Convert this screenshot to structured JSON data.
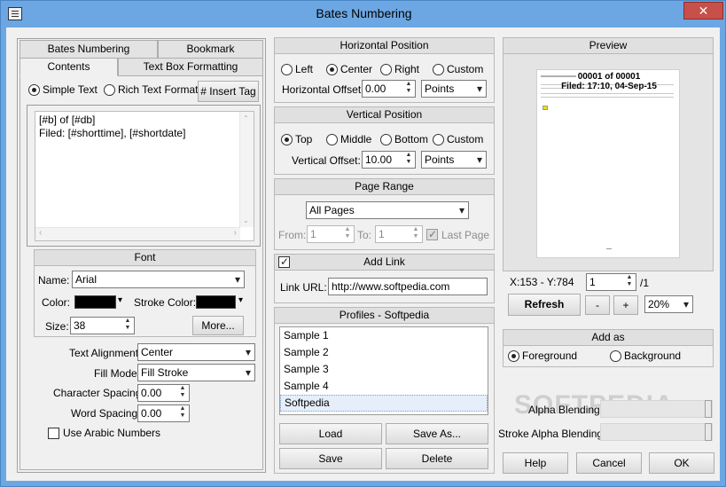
{
  "window": {
    "title": "Bates Numbering",
    "close_glyph": "✕",
    "min_glyph": "─",
    "max_glyph": "☐"
  },
  "left": {
    "tabs_row1": [
      "Bates Numbering",
      "Bookmark"
    ],
    "tabs_row2": [
      "Contents",
      "Text Box Formatting"
    ],
    "text_mode": {
      "simple": "Simple Text",
      "rich": "Rich Text Format",
      "selected": "simple"
    },
    "insert_tag": "# Insert Tag",
    "editor_lines": [
      "[#b] of [#db]",
      "Filed: [#shorttime], [#shortdate]"
    ],
    "font": {
      "header": "Font",
      "name_label": "Name:",
      "name_value": "Arial",
      "color_label": "Color:",
      "color_value": "#000000",
      "stroke_color_label": "Stroke Color:",
      "stroke_color_value": "#000000",
      "size_label": "Size:",
      "size_value": "38",
      "more_button": "More..."
    },
    "text_alignment": {
      "label": "Text Alignment:",
      "value": "Center"
    },
    "fill_mode": {
      "label": "Fill Mode:",
      "value": "Fill Stroke"
    },
    "char_spacing": {
      "label": "Character Spacing:",
      "value": "0.00"
    },
    "word_spacing": {
      "label": "Word Spacing:",
      "value": "0.00"
    },
    "arabic": {
      "label": "Use Arabic Numbers",
      "checked": false
    }
  },
  "horizontal": {
    "header": "Horizontal Position",
    "options": [
      "Left",
      "Center",
      "Right",
      "Custom"
    ],
    "selected": "Center",
    "offset_label": "Horizontal Offset:",
    "offset_value": "0.00",
    "units": "Points"
  },
  "vertical": {
    "header": "Vertical Position",
    "options": [
      "Top",
      "Middle",
      "Bottom",
      "Custom"
    ],
    "selected": "Top",
    "offset_label": "Vertical Offset:",
    "offset_value": "10.00",
    "units": "Points"
  },
  "page_range": {
    "header": "Page Range",
    "value": "All Pages",
    "from_label": "From:",
    "from_value": "1",
    "to_label": "To:",
    "to_value": "1",
    "last_page_label": "Last Page",
    "last_page_checked": true
  },
  "add_link": {
    "label": "Add Link",
    "checked": true,
    "url_label": "Link URL:",
    "url_value": "http://www.softpedia.com"
  },
  "profiles": {
    "header": "Profiles - Softpedia",
    "items": [
      "Sample 1",
      "Sample 2",
      "Sample 3",
      "Sample 4",
      "Softpedia"
    ],
    "selected": "Softpedia",
    "load": "Load",
    "save_as": "Save As...",
    "save": "Save",
    "delete": "Delete"
  },
  "preview": {
    "header": "Preview",
    "stamp_line1": "00001 of 00001",
    "stamp_line2": "Filed: 17:10, 04-Sep-15",
    "coords": "X:153  -  Y:784",
    "page_value": "1",
    "page_total": "/1",
    "refresh": "Refresh",
    "minus": "-",
    "plus": "+",
    "zoom": "20%"
  },
  "add_as": {
    "header": "Add as",
    "options": [
      "Foreground",
      "Background"
    ],
    "selected": "Foreground"
  },
  "alpha": {
    "label": "Alpha Blending:",
    "level": 1.0
  },
  "stroke_alpha": {
    "label": "Stroke Alpha Blending:",
    "level": 1.0
  },
  "watermark": "SOFTPEDIA",
  "buttons": {
    "help": "Help",
    "cancel": "Cancel",
    "ok": "OK"
  },
  "colors": {
    "titlebar": "#6ca7e3",
    "close": "#c7504b",
    "dialog": "#f0f0f0"
  }
}
